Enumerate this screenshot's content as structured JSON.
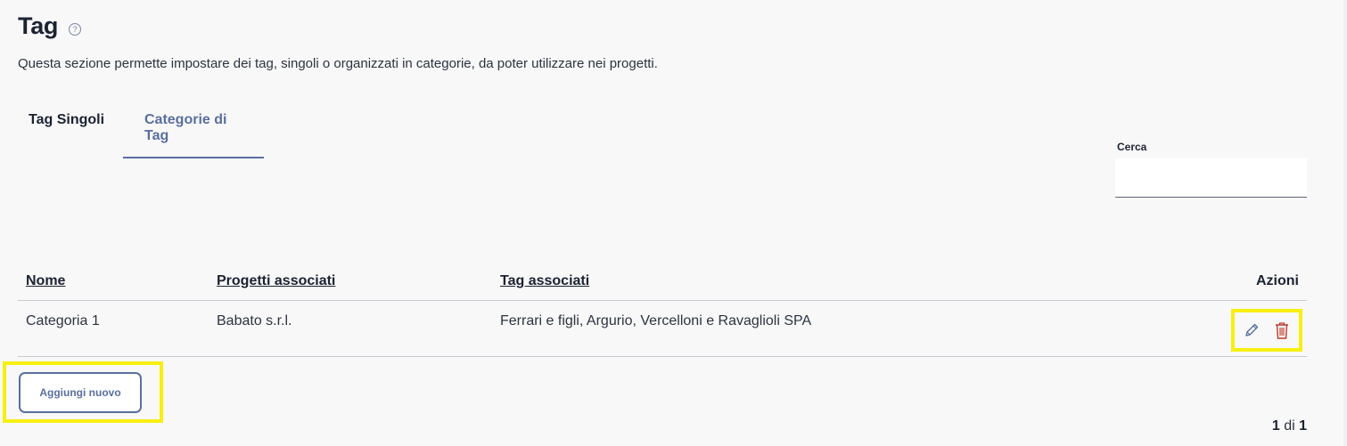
{
  "header": {
    "title": "Tag",
    "help_icon": "?",
    "description": "Questa sezione permette impostare dei tag, singoli o organizzati in categorie, da poter utilizzare nei progetti."
  },
  "tabs": [
    {
      "label": "Tag Singoli",
      "active": false
    },
    {
      "label": "Categorie di Tag",
      "active": true
    }
  ],
  "search": {
    "label": "Cerca",
    "value": "",
    "placeholder": ""
  },
  "table": {
    "headers": {
      "nome": "Nome",
      "progetti": "Progetti associati",
      "tag": "Tag associati",
      "azioni": "Azioni"
    },
    "rows": [
      {
        "nome": "Categoria 1",
        "progetti": "Babato s.r.l.",
        "tag": "Ferrari e figli, Argurio, Vercelloni e Ravaglioli SPA",
        "actions": [
          "pencil-icon",
          "trash-icon"
        ]
      }
    ]
  },
  "add_button": {
    "label": "Aggiungi nuovo"
  },
  "pagination": {
    "current": "1",
    "separator": "di",
    "total": "1"
  },
  "colors": {
    "accent": "#5a6fa0",
    "delete": "#c0392b",
    "highlight": "#f7ef10",
    "text": "#1b2332"
  }
}
